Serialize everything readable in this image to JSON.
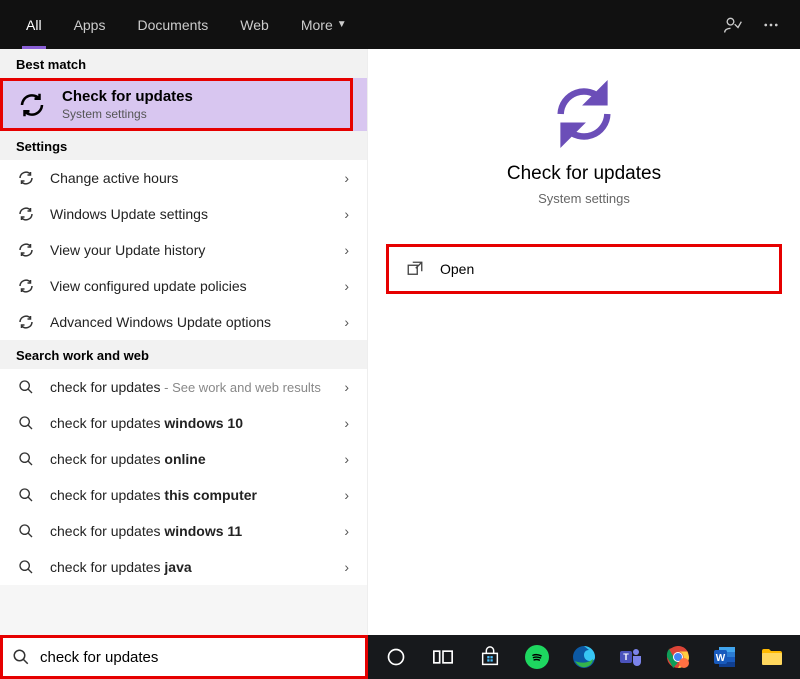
{
  "topbar": {
    "tabs": [
      "All",
      "Apps",
      "Documents",
      "Web",
      "More"
    ],
    "active_index": 0
  },
  "left": {
    "best_match_header": "Best match",
    "best_match": {
      "title": "Check for updates",
      "subtitle": "System settings"
    },
    "settings_header": "Settings",
    "settings": [
      "Change active hours",
      "Windows Update settings",
      "View your Update history",
      "View configured update policies",
      "Advanced Windows Update options"
    ],
    "web_header": "Search work and web",
    "web_first": {
      "prefix": "check for updates",
      "suffix": " - See work and web results"
    },
    "web_suggestions": [
      {
        "prefix": "check for updates ",
        "bold": "windows 10"
      },
      {
        "prefix": "check for updates ",
        "bold": "online"
      },
      {
        "prefix": "check for updates ",
        "bold": "this computer"
      },
      {
        "prefix": "check for updates ",
        "bold": "windows 11"
      },
      {
        "prefix": "check for updates ",
        "bold": "java"
      }
    ]
  },
  "right": {
    "title": "Check for updates",
    "subtitle": "System settings",
    "open_label": "Open"
  },
  "search": {
    "value": "check for updates"
  }
}
